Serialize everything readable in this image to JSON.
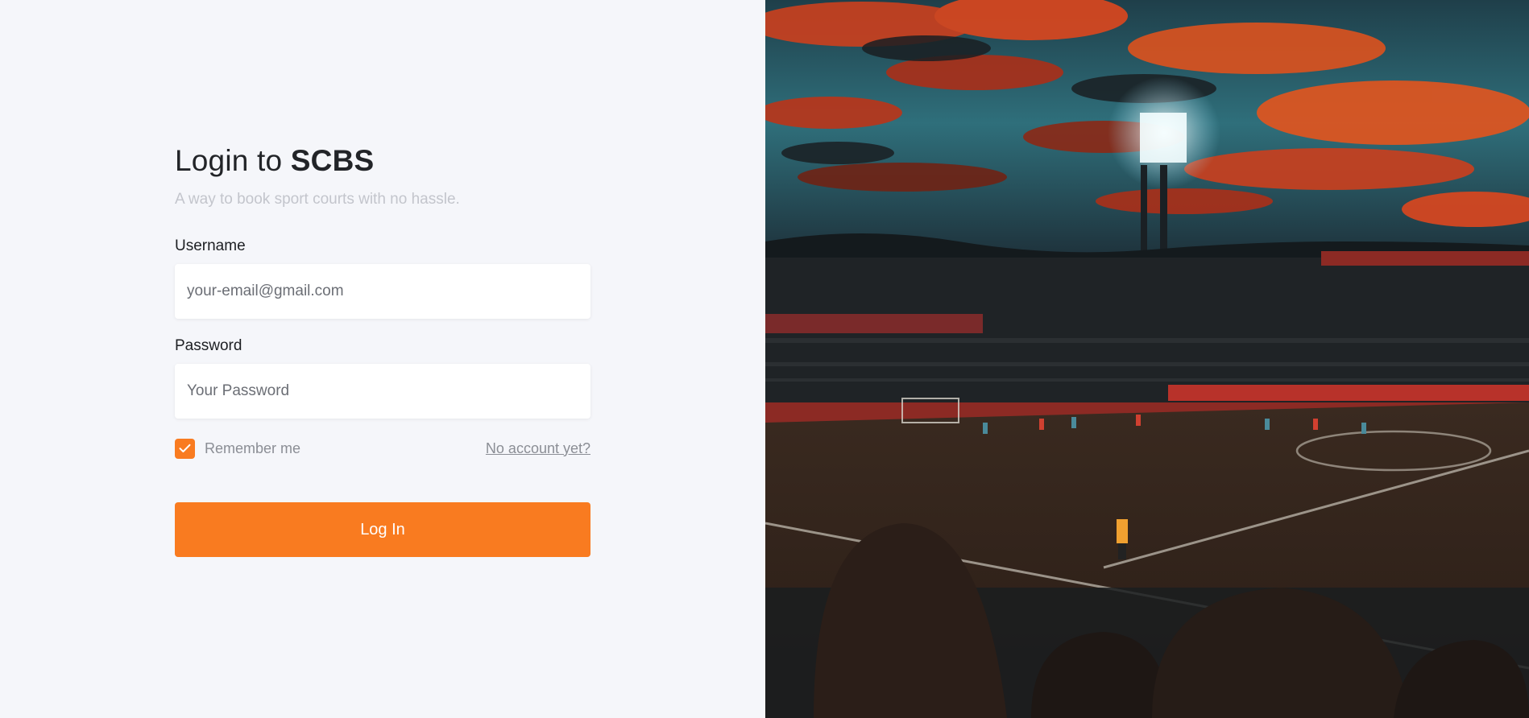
{
  "login": {
    "title_prefix": "Login to",
    "title_brand": "SCBS",
    "subtitle": "A way to book sport courts with no hassle.",
    "username_label": "Username",
    "username_placeholder": "your-email@gmail.com",
    "password_label": "Password",
    "password_placeholder": "Your Password",
    "remember_label": "Remember me",
    "remember_checked": true,
    "signup_link": "No account yet?",
    "submit_label": "Log In"
  },
  "colors": {
    "accent": "#f97b20",
    "background": "#f5f6fa"
  },
  "hero_image": {
    "icon": "stadium-photo"
  }
}
